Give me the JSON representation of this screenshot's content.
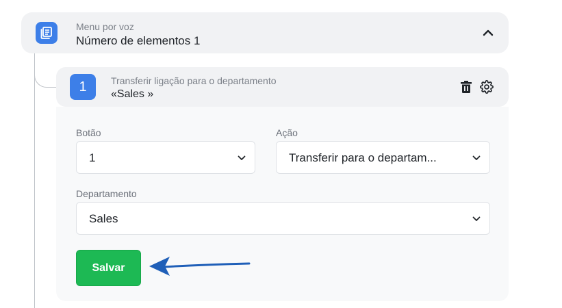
{
  "header": {
    "subtitle": "Menu por voz",
    "title": "Número de elementos 1",
    "icon": "list-icon",
    "accent": "#3d7fe8"
  },
  "item": {
    "number": "1",
    "subtitle": "Transferir ligação para o departamento",
    "title": "«Sales »"
  },
  "form": {
    "button_label": "Botão",
    "button_value": "1",
    "action_label": "Ação",
    "action_value": "Transferir para o departam...",
    "department_label": "Departamento",
    "department_value": "Sales",
    "save_label": "Salvar",
    "save_color": "#1db954"
  }
}
